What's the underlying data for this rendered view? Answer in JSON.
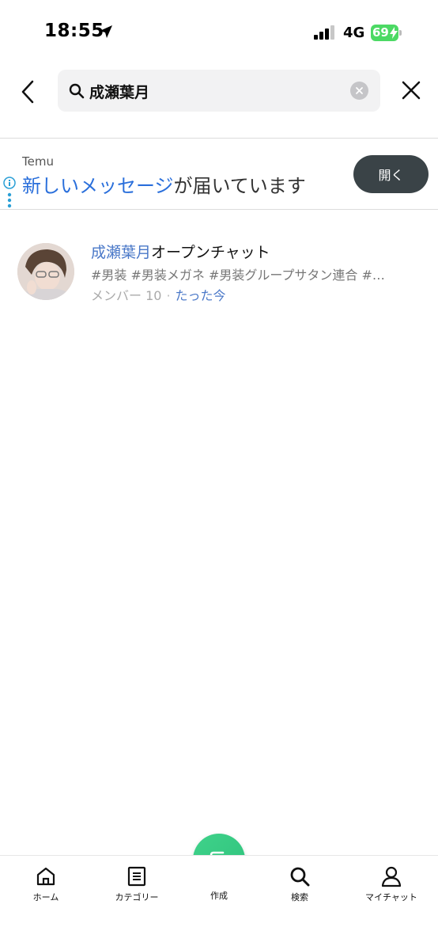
{
  "status_bar": {
    "time": "18:55",
    "network": "4G",
    "battery": "69"
  },
  "search": {
    "query": "成瀬葉月"
  },
  "ad": {
    "brand": "Temu",
    "message_highlight": "新しいメッセージ",
    "message_rest": "が届いています",
    "open_label": "開く"
  },
  "results": [
    {
      "title_highlight": "成瀬葉月",
      "title_rest": "オープンチャット",
      "tags": "#男装 #男装メガネ #男装グループサタン連合 #…",
      "members": "メンバー 10",
      "separator": "·",
      "updated": "たった今"
    }
  ],
  "tabbar": {
    "home": "ホーム",
    "category": "カテゴリー",
    "create": "作成",
    "search": "検索",
    "mychat": "マイチャット"
  },
  "colors": {
    "accent_green": "#3fd28a",
    "link_blue": "#4a78c8",
    "ad_button": "#3a4347"
  }
}
